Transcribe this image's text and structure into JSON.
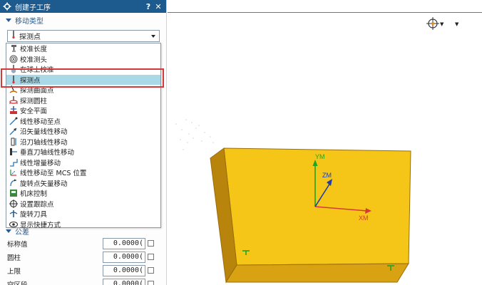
{
  "window": {
    "title": "创建子工序",
    "help": "?",
    "close": "✕"
  },
  "motion_type": {
    "header": "移动类型",
    "selected": "探测点"
  },
  "dropdown_items": [
    {
      "label": "校准长度",
      "icon": "calibrate-length-icon"
    },
    {
      "label": "校准测头",
      "icon": "calibrate-probe-icon"
    },
    {
      "label": "在球上校准",
      "icon": "calibrate-on-sphere-icon"
    },
    {
      "label": "探测点",
      "icon": "probe-point-icon",
      "selected": true
    },
    {
      "label": "探测曲面点",
      "icon": "probe-surface-point-icon"
    },
    {
      "label": "探测圆柱",
      "icon": "probe-cylinder-icon"
    },
    {
      "label": "安全平面",
      "icon": "safe-plane-icon"
    },
    {
      "label": "线性移动至点",
      "icon": "linear-move-to-point-icon"
    },
    {
      "label": "沿矢量线性移动",
      "icon": "linear-move-along-vector-icon"
    },
    {
      "label": "沿刀轴线性移动",
      "icon": "linear-move-along-tool-axis-icon"
    },
    {
      "label": "垂直刀轴线性移动",
      "icon": "linear-move-perpendicular-icon"
    },
    {
      "label": "线性增量移动",
      "icon": "linear-incremental-move-icon"
    },
    {
      "label": "线性移动至 MCS 位置",
      "icon": "linear-move-to-mcs-icon"
    },
    {
      "label": "旋转点矢量移动",
      "icon": "rotate-point-vector-icon"
    },
    {
      "label": "机床控制",
      "icon": "machine-control-icon"
    },
    {
      "label": "设置跟踪点",
      "icon": "set-tracking-point-icon"
    },
    {
      "label": "旋转刀具",
      "icon": "rotate-tool-icon"
    },
    {
      "label": "显示快捷方式",
      "icon": "show-shortcuts-icon"
    }
  ],
  "tolerance": {
    "header": "公差",
    "fields": [
      {
        "label": "标称值",
        "value": "0.0000("
      },
      {
        "label": "圆柱",
        "value": "0.0000("
      },
      {
        "label": "上限",
        "value": "0.0000("
      },
      {
        "label": "空区段",
        "value": "0.0000("
      }
    ]
  },
  "viewport": {
    "axes": {
      "x": "XM",
      "y": "YM",
      "z": "ZM"
    }
  },
  "colors": {
    "titlebar": "#1d5b8f",
    "selected_row": "#a9d8e6",
    "highlight": "#d43a3a",
    "block_top": "#f5c518",
    "block_front": "#d9a213",
    "block_side": "#b8840c"
  }
}
